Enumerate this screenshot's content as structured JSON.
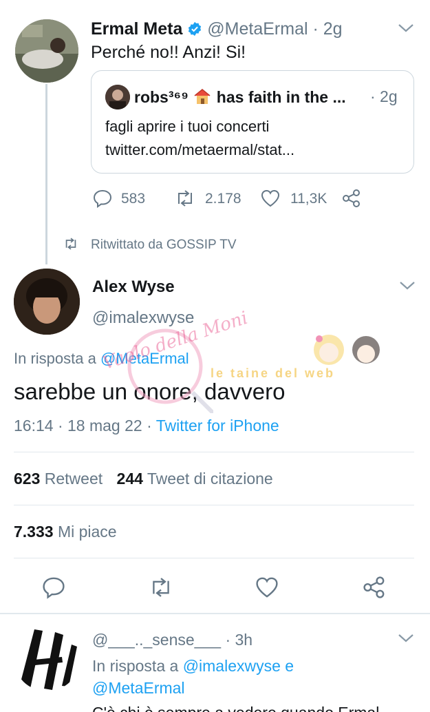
{
  "tweet1": {
    "name": "Ermal Meta",
    "handle": "@MetaErmal",
    "time": "· 2g",
    "text": "Perché no!! Anzi! Si!",
    "quote": {
      "name": "robs³⁶⁹",
      "name_suffix": "has faith in the ...",
      "time": "· 2g",
      "line1": "fagli aprire i tuoi concerti",
      "line2": "twitter.com/metaermal/stat..."
    },
    "replies": "583",
    "retweets": "2.178",
    "likes": "11,3K"
  },
  "retweet_note": "Ritwittato da GOSSIP TV",
  "main_tweet": {
    "name": "Alex Wyse",
    "handle": "@imalexwyse",
    "reply_prefix": "In risposta a",
    "reply_to": "@MetaErmal",
    "text": "sarebbe un onore, davvero",
    "timestamp": "16:14 · 18 mag 22 ·",
    "client": "Twitter for iPhone",
    "retweet_count": "623",
    "retweet_label": "Retweet",
    "quote_count": "244",
    "quote_label": "Tweet di citazione",
    "like_count": "7.333",
    "like_label": "Mi piace"
  },
  "watermark": {
    "script_text": "Vaolo della Moni",
    "banner_text": "le taine del web"
  },
  "reply_tweet": {
    "handle_partial": "@___.._sense___",
    "time": "· 3h",
    "reply_prefix": "In risposta a",
    "reply_to_1": "@imalexwyse",
    "conj": "e",
    "reply_to_2": "@MetaErmal",
    "partial_text": "C'è chi è sempre a vedere quando Ermal"
  },
  "colors": {
    "accent": "#1da1f2",
    "secondary_text": "#657786",
    "divider": "#e1e8ed",
    "verified": "#1da1f2"
  }
}
